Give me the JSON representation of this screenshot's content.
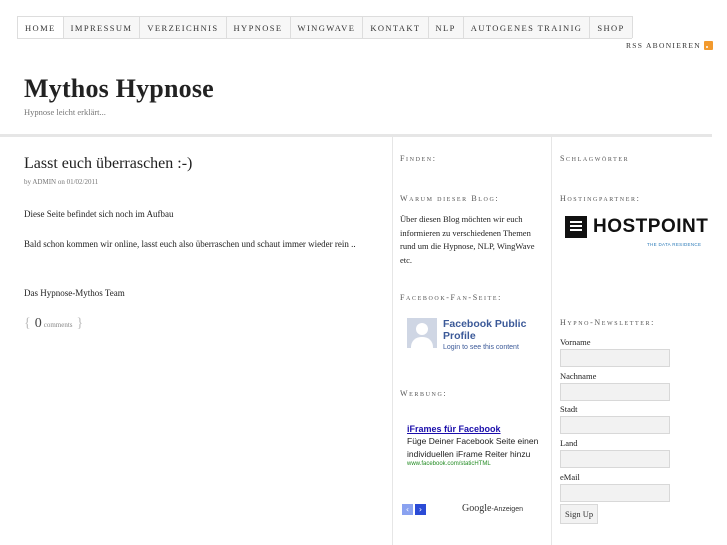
{
  "nav": {
    "items": [
      "HOME",
      "IMPRESSUM",
      "VERZEICHNIS",
      "HYPNOSE",
      "WINGWAVE",
      "KONTAKT",
      "NLP",
      "AUTOGENES TRAINIG",
      "SHOP"
    ]
  },
  "rss": {
    "label": "RSS ABONIEREN"
  },
  "site": {
    "title": "Mythos Hypnose",
    "description": "Hypnose leicht erklärt..."
  },
  "post": {
    "title": "Lasst euch überraschen :-)",
    "meta": "by ADMIN on 01/02/2011",
    "paragraphs": [
      "Diese Seite befindet sich noch im Aufbau",
      "Bald schon kommen wir online, lasst euch also überraschen und schaut immer wieder rein ..",
      "Das Hypnose-Mythos Team"
    ],
    "comments_count": "0",
    "comments_label": "comments"
  },
  "sidebar1": {
    "find_title": "Finden:",
    "why_title": "Warum dieser Blog:",
    "why_text": "Über diesen Blog möchten wir euch informieren zu verschiedenen Themen rund um die Hypnose, NLP, WingWave etc.",
    "fb_title": "Facebook-Fan-Seite:",
    "fb_name": "Facebook Public Profile",
    "fb_sub": "Login to see this content",
    "ads_title": "Werbung:",
    "ad": {
      "title": "iFrames für Facebook",
      "body": "Füge Deiner Facebook Seite einen individuellen iFrame Reiter hinzu",
      "url": "www.facebook.com/staticHTML",
      "google": "Google",
      "google_suffix": "-Anzeigen"
    }
  },
  "sidebar2": {
    "tags_title": "Schlagwörter",
    "hosting_title": "Hostingpartner:",
    "hostpoint_name": "HOSTPOINT",
    "hostpoint_tagline": "THE DATA RESIDENCE",
    "newsletter_title": "Hypno-Newsletter:",
    "fields": [
      "Vorname",
      "Nachname",
      "Stadt",
      "Land",
      "eMail"
    ],
    "signup_label": "Sign Up"
  },
  "colors": {
    "facebook_blue": "#3b5998",
    "ad_link": "#1a0dab",
    "rss_orange": "#f29a2e"
  }
}
